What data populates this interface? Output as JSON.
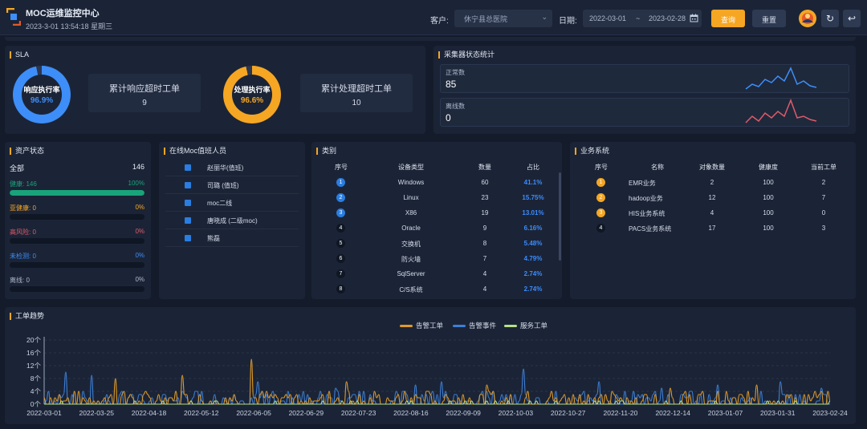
{
  "header": {
    "title": "MOC运维监控中心",
    "datetime": "2023-3-01 13:54:18 星期三",
    "customer_label": "客户:",
    "customer_value": "休宁县总医院",
    "date_label": "日期:",
    "date_start": "2022-03-01",
    "date_sep": "~",
    "date_end": "2023-02-28",
    "query_label": "查询",
    "reset_label": "重置"
  },
  "sla": {
    "title": "SLA",
    "response_rate": {
      "label": "响应执行率",
      "value": "96.9%",
      "percent": 96.9,
      "color": "#3d8ef8"
    },
    "response_overtime": {
      "label": "累计响应超时工单",
      "value": "9"
    },
    "process_rate": {
      "label": "处理执行率",
      "value": "96.6%",
      "percent": 96.6,
      "color": "#f5a623"
    },
    "process_overtime": {
      "label": "累计处理超时工单",
      "value": "10"
    }
  },
  "collector": {
    "title": "采集器状态统计",
    "normal": {
      "label": "正常数",
      "value": "85",
      "color": "#3d8ef8"
    },
    "offline": {
      "label": "离线数",
      "value": "0",
      "color": "#e05a6a"
    }
  },
  "assets": {
    "title": "资产状态",
    "total_label": "全部",
    "total_value": "146",
    "rows": [
      {
        "label": "健康: 146",
        "value": "100%",
        "percent": 100,
        "color": "#19a37a"
      },
      {
        "label": "亚健康: 0",
        "value": "0%",
        "percent": 0,
        "color": "#f5a623"
      },
      {
        "label": "高风险: 0",
        "value": "0%",
        "percent": 0,
        "color": "#e05a6a"
      },
      {
        "label": "未检测: 0",
        "value": "0%",
        "percent": 0,
        "color": "#3d8ef8"
      },
      {
        "label": "离线: 0",
        "value": "0%",
        "percent": 0,
        "color": "#aeb8cc"
      }
    ]
  },
  "staff": {
    "title": "在线Moc值班人员",
    "items": [
      "赵丽华(值班)",
      "司璐 (值班)",
      "moc二线",
      "唐晓成 (二级moc)",
      "熊磊"
    ]
  },
  "category": {
    "title": "类别",
    "headers": [
      "序号",
      "设备类型",
      "数量",
      "占比"
    ],
    "rows": [
      [
        "1",
        "Windows",
        "60",
        "41.1%"
      ],
      [
        "2",
        "Linux",
        "23",
        "15.75%"
      ],
      [
        "3",
        "X86",
        "19",
        "13.01%"
      ],
      [
        "4",
        "Oracle",
        "9",
        "6.16%"
      ],
      [
        "5",
        "交换机",
        "8",
        "5.48%"
      ],
      [
        "6",
        "防火墙",
        "7",
        "4.79%"
      ],
      [
        "7",
        "SqlServer",
        "4",
        "2.74%"
      ],
      [
        "8",
        "C/S系统",
        "4",
        "2.74%"
      ]
    ]
  },
  "business": {
    "title": "业务系统",
    "headers": [
      "序号",
      "名称",
      "对象数量",
      "健康度",
      "当前工单"
    ],
    "rows": [
      [
        "1",
        "EMR业务",
        "2",
        "100",
        "2"
      ],
      [
        "2",
        "hadoop业务",
        "12",
        "100",
        "7"
      ],
      [
        "3",
        "HIS业务系统",
        "4",
        "100",
        "0"
      ],
      [
        "4",
        "PACS业务系统",
        "17",
        "100",
        "3"
      ]
    ]
  },
  "trend": {
    "title": "工单趋势",
    "chart_data": {
      "type": "line",
      "ylim": [
        0,
        20
      ],
      "yticks": [
        "0个",
        "4个",
        "8个",
        "12个",
        "16个",
        "20个"
      ],
      "xticks": [
        "2022-03-01",
        "2022-03-25",
        "2022-04-18",
        "2022-05-12",
        "2022-06-05",
        "2022-06-29",
        "2022-07-23",
        "2022-08-16",
        "2022-09-09",
        "2022-10-03",
        "2022-10-27",
        "2022-11-20",
        "2022-12-14",
        "2023-01-07",
        "2023-01-31",
        "2023-02-24"
      ],
      "series": [
        {
          "name": "告警工单",
          "color": "#e09a28"
        },
        {
          "name": "告警事件",
          "color": "#3d7fd6"
        },
        {
          "name": "服务工单",
          "color": "#b6e08a"
        }
      ]
    }
  }
}
